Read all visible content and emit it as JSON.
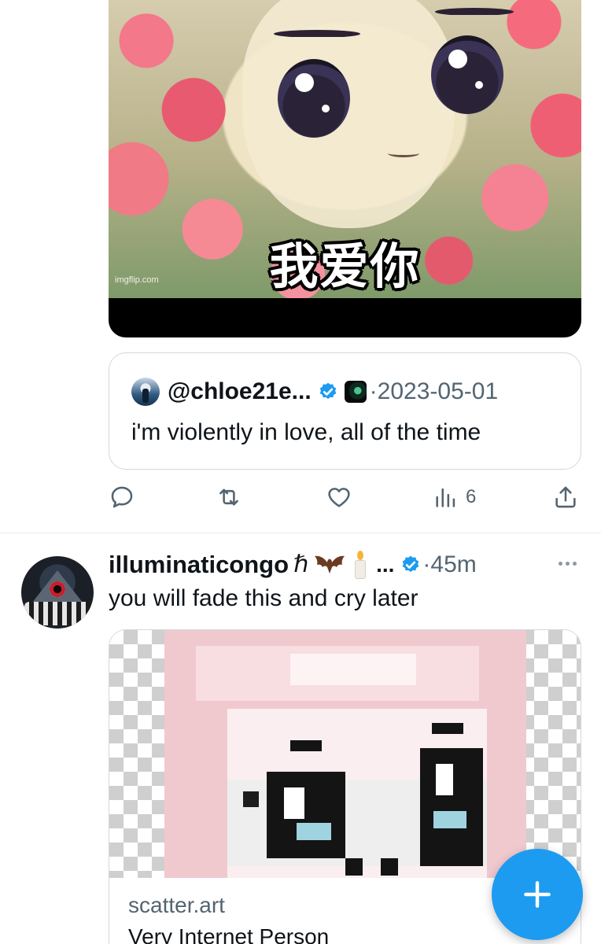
{
  "top_media": {
    "overlay_text": "我爱你",
    "watermark": "imgflip.com"
  },
  "quoted_tweet": {
    "handle": "@chloe21e...",
    "separator": "·",
    "date": "2023-05-01",
    "text": "i'm violently in love, all of the time"
  },
  "actions": {
    "views_count": "6"
  },
  "tweet": {
    "display_name": "illuminaticongo",
    "name_emoji": "ℏ",
    "truncation": "...",
    "separator": "·",
    "time": "45m",
    "text": "you will fade this and cry later"
  },
  "link_card": {
    "domain": "scatter.art",
    "title": "Very Internet Person"
  },
  "icons": {
    "reply": "reply-icon",
    "retweet": "retweet-icon",
    "like": "heart-icon",
    "views": "views-icon",
    "share": "share-icon",
    "compose": "plus-icon",
    "more": "more-icon"
  },
  "colors": {
    "accent": "#1d9bf0",
    "secondary_text": "#536471",
    "primary_text": "#0f1419",
    "border": "#cfd9de"
  }
}
